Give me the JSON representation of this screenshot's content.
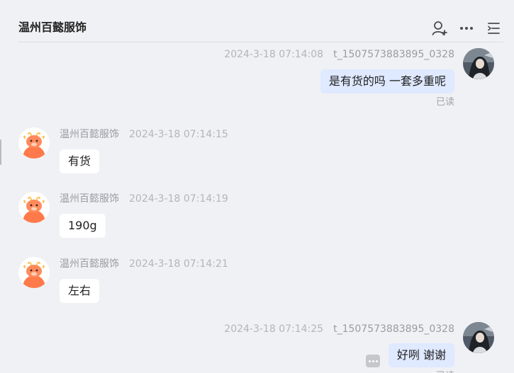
{
  "header": {
    "title": "温州百懿服饰",
    "icons": [
      "add-contact-icon",
      "more-icon",
      "menu-list-icon"
    ]
  },
  "messages": [
    {
      "sender": "t_1507573883895_0328",
      "time": "2024-3-18 07:14:08",
      "text": "是有货的吗 一套多重呢",
      "side": "right",
      "status": "已读"
    },
    {
      "sender": "温州百懿服饰",
      "time": "2024-3-18 07:14:15",
      "text": "有货",
      "side": "left"
    },
    {
      "sender": "温州百懿服饰",
      "time": "2024-3-18 07:14:19",
      "text": "190g",
      "side": "left"
    },
    {
      "sender": "温州百懿服饰",
      "time": "2024-3-18 07:14:21",
      "text": "左右",
      "side": "left"
    },
    {
      "sender": "t_1507573883895_0328",
      "time": "2024-3-18 07:14:25",
      "text": "好咧 谢谢",
      "side": "right",
      "status": "已读"
    }
  ],
  "colors": {
    "background": "#f0f1f5",
    "my_bubble": "#dfe9ff",
    "their_bubble": "#ffffff",
    "shop_avatar": "#ff7a4a"
  }
}
